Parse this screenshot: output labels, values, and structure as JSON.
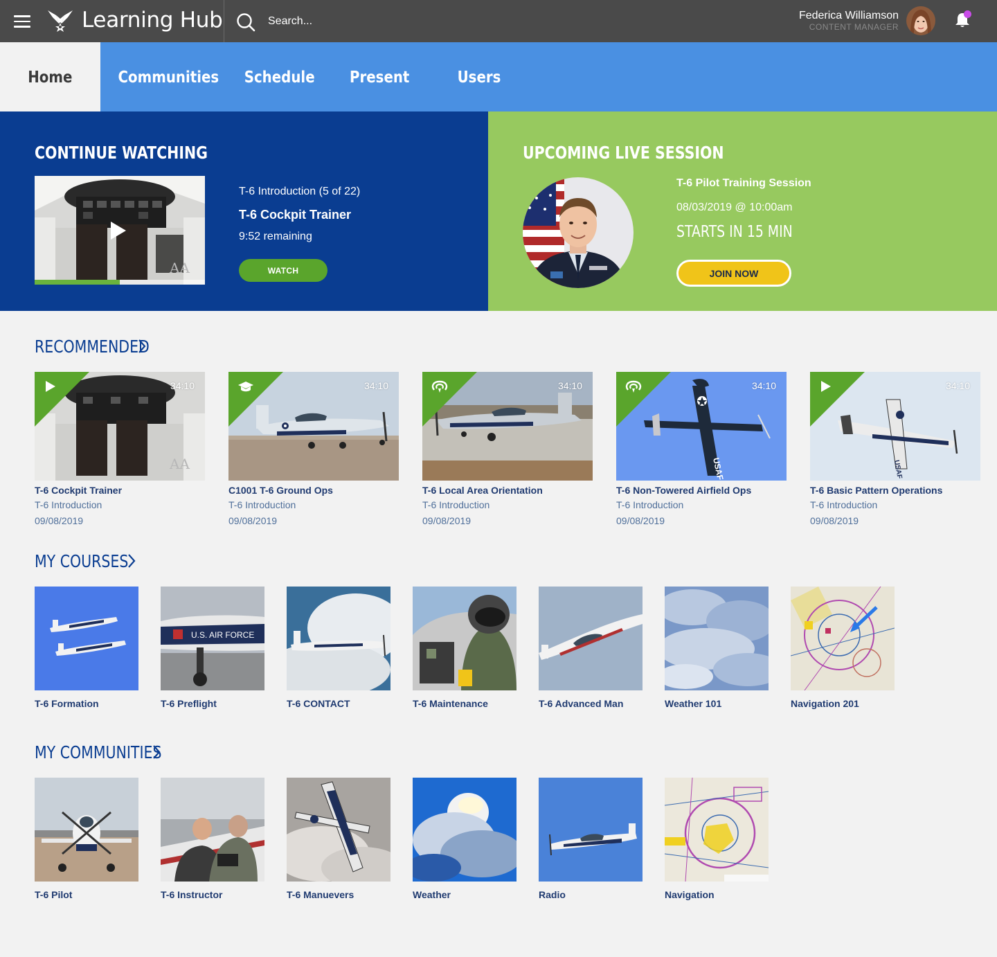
{
  "header": {
    "app_title": "Learning Hub",
    "search_placeholder": "Search...",
    "user_name": "Federica Williamson",
    "user_role": "CONTENT MANAGER"
  },
  "nav": {
    "items": [
      {
        "label": "Home",
        "active": true
      },
      {
        "label": "Communities",
        "active": false
      },
      {
        "label": "Schedule",
        "active": false
      },
      {
        "label": "Present",
        "active": false
      },
      {
        "label": "Users",
        "active": false
      }
    ]
  },
  "continue_watching": {
    "heading": "CONTINUE WATCHING",
    "course_progress": "T-6 Introduction (5 of 22)",
    "title": "T-6 Cockpit Trainer",
    "remaining": "9:52 remaining",
    "watch_label": "WATCH",
    "progress_fraction": 0.5
  },
  "upcoming": {
    "heading": "UPCOMING LIVE SESSION",
    "title": "T-6 Pilot Training Session",
    "datetime": "08/03/2019 @ 10:00am",
    "starts_in": "STARTS IN 15 MIN",
    "join_label": "JOIN NOW"
  },
  "recommended": {
    "heading": "RECOMMENDED",
    "items": [
      {
        "title": "T-6 Cockpit Trainer",
        "course": "T-6 Introduction",
        "date": "09/08/2019",
        "duration": "34:10",
        "type_icon": "play-icon"
      },
      {
        "title": "C1001 T-6 Ground Ops",
        "course": "T-6 Introduction",
        "date": "09/08/2019",
        "duration": "34:10",
        "type_icon": "graduation-cap-icon"
      },
      {
        "title": "T-6 Local Area Orientation",
        "course": "T-6 Introduction",
        "date": "09/08/2019",
        "duration": "34:10",
        "type_icon": "live-stream-icon"
      },
      {
        "title": "T-6 Non-Towered Airfield Ops",
        "course": "T-6 Introduction",
        "date": "09/08/2019",
        "duration": "34:10",
        "type_icon": "live-stream-icon"
      },
      {
        "title": "T-6 Basic Pattern Operations",
        "course": "T-6 Introduction",
        "date": "09/08/2019",
        "duration": "34:10",
        "type_icon": "play-icon"
      }
    ]
  },
  "my_courses": {
    "heading": "MY COURSES",
    "items": [
      {
        "label": "T-6 Formation"
      },
      {
        "label": "T-6 Preflight"
      },
      {
        "label": "T-6 CONTACT"
      },
      {
        "label": "T-6 Maintenance"
      },
      {
        "label": "T-6 Advanced Man"
      },
      {
        "label": "Weather 101"
      },
      {
        "label": "Navigation 201"
      }
    ]
  },
  "my_communities": {
    "heading": "MY COMMUNITIES",
    "items": [
      {
        "label": "T-6 Pilot"
      },
      {
        "label": "T-6 Instructor"
      },
      {
        "label": "T-6 Manuevers"
      },
      {
        "label": "Weather"
      },
      {
        "label": "Radio"
      },
      {
        "label": "Navigation"
      }
    ]
  },
  "colors": {
    "topbar": "#4a4a4a",
    "nav": "#4a90e2",
    "continue_bg": "#0a3d91",
    "upcoming_bg": "#97c95f",
    "accent_green": "#5aa52c",
    "join_yellow": "#f0c419",
    "heading_blue": "#0a3d91",
    "notification_dot": "#c94ce8"
  }
}
